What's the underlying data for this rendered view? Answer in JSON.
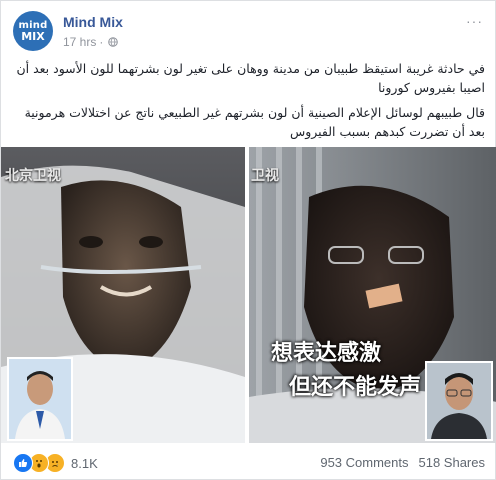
{
  "post": {
    "page_name": "Mind Mix",
    "avatar_line1": "mind",
    "avatar_line2": "MIX",
    "time": "17 hrs",
    "dot": "·",
    "more": "···",
    "paragraph1": "في حادثة غريبة استيقظ طبيبان من مدينة ووهان على تغير لون بشرتهما للون الأسود بعد أن اصيبا بفيروس كورونا",
    "paragraph2": "قال طبيبهم لوسائل الإعلام الصينية أن لون بشرتهم غير الطبيعي ناتج عن اختلالات هرمونية بعد أن تضررت كبدهم بسبب الفيروس"
  },
  "media": {
    "left_watermark": "北京卫视",
    "right_watermark": "卫视",
    "subtitle_line1": "想表达感激",
    "subtitle_line2": "但还不能发声"
  },
  "footer": {
    "reaction_count": "8.1K",
    "comments": "953 Comments",
    "shares": "518 Shares"
  },
  "colors": {
    "brand": "#385898",
    "like": "#1877f2",
    "wow": "#f7b125",
    "sad": "#f7b125"
  },
  "icons": [
    "globe-icon",
    "like-icon",
    "wow-icon",
    "sad-icon",
    "more-icon"
  ]
}
